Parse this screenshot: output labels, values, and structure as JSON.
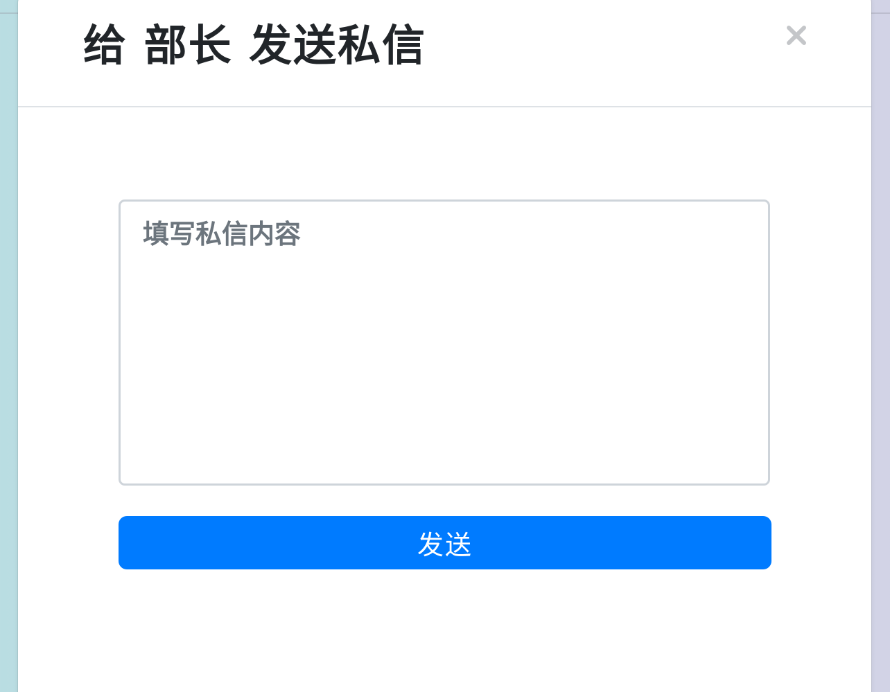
{
  "dialog": {
    "title": "给 部长 发送私信",
    "close_label": "×",
    "close_icon": "close-icon"
  },
  "form": {
    "message": {
      "value": "",
      "placeholder": "填写私信内容"
    },
    "send_label": "发送"
  },
  "colors": {
    "primary": "#007bff",
    "title_text": "#212529",
    "placeholder_text": "#6c757d",
    "close_icon": "#c4c6c9",
    "input_border": "#ced4da",
    "divider": "#dee2e6"
  }
}
